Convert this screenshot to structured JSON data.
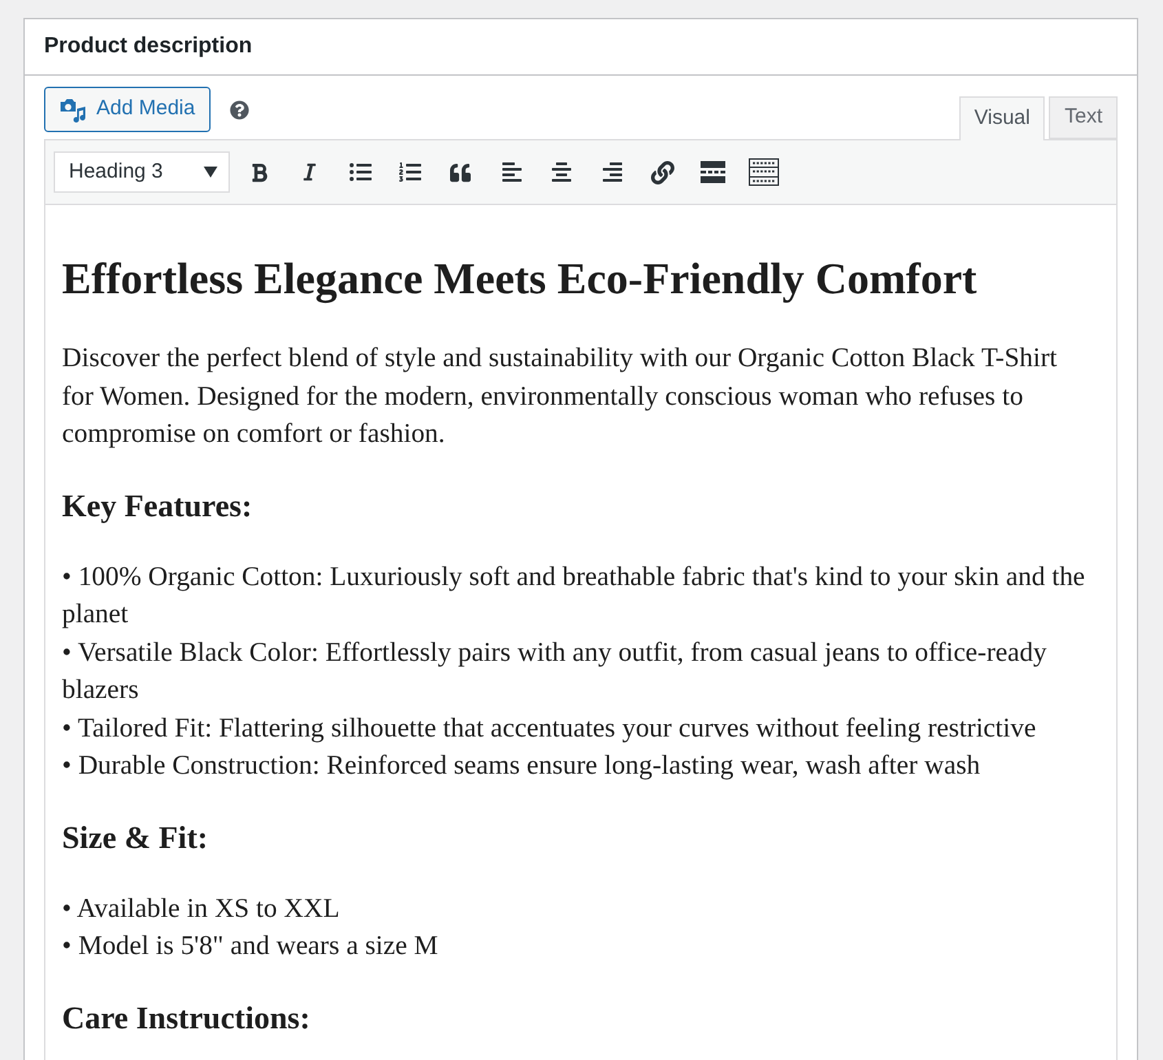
{
  "panel": {
    "title": "Product description"
  },
  "media_button": {
    "label": "Add Media"
  },
  "tabs": [
    {
      "label": "Visual",
      "selected": true
    },
    {
      "label": "Text",
      "selected": false
    }
  ],
  "format_select": {
    "value": "Heading 3"
  },
  "content": [
    {
      "kind": "heading",
      "text": "Effortless Elegance Meets Eco-Friendly Comfort"
    },
    {
      "kind": "paragraph",
      "text": "Discover the perfect blend of style and sustainability with our Organic Cotton Black T-Shirt for Women. Designed for the modern, environmentally conscious woman who refuses to compromise on comfort or fashion."
    },
    {
      "kind": "subheading",
      "text": "Key Features:"
    },
    {
      "kind": "lines",
      "lines": [
        "• 100% Organic Cotton: Luxuriously soft and breathable fabric that's kind to your skin and the planet",
        "• Versatile Black Color: Effortlessly pairs with any outfit, from casual jeans to office-ready blazers",
        "• Tailored Fit: Flattering silhouette that accentuates your curves without feeling restrictive",
        "• Durable Construction: Reinforced seams ensure long-lasting wear, wash after wash"
      ]
    },
    {
      "kind": "subheading",
      "text": "Size & Fit:"
    },
    {
      "kind": "lines",
      "lines": [
        "• Available in XS to XXL",
        "• Model is 5'8\" and wears a size M"
      ]
    },
    {
      "kind": "subheading",
      "text": "Care Instructions:"
    }
  ]
}
